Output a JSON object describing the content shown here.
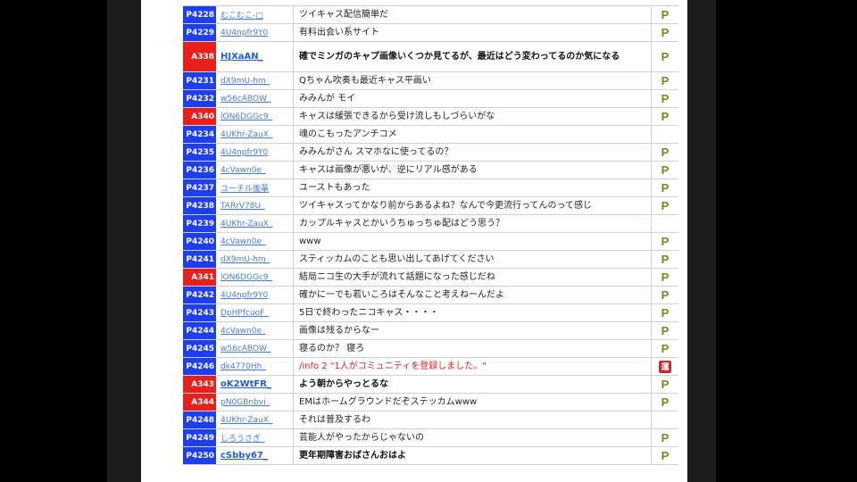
{
  "comments": [
    {
      "no": "P4228",
      "color": "blue",
      "user": "むこむこ-□",
      "user_bold": false,
      "text": "ツイキャス配信簡単だ",
      "text_style": "normal",
      "flag": "P"
    },
    {
      "no": "P4229",
      "color": "blue",
      "user": "4U4npfr9Y0",
      "user_bold": false,
      "text": "有料出会い系サイト",
      "text_style": "normal",
      "flag": "P"
    },
    {
      "no": "A338",
      "color": "red",
      "user": "HJXaAN_",
      "user_bold": true,
      "text": "確でミンガのキャプ画像いくつか見てるが、最近はどう変わってるのか気になる",
      "text_style": "bold",
      "flag": "P",
      "tall": true
    },
    {
      "no": "P4231",
      "color": "blue",
      "user": "dX9mU-hm_",
      "user_bold": false,
      "text": "Qちゃん吹奏も最近キャス平画い",
      "text_style": "normal",
      "flag": "P"
    },
    {
      "no": "P4232",
      "color": "blue",
      "user": "w56cABOW_",
      "user_bold": false,
      "text": "みみんが モイ",
      "text_style": "normal",
      "flag": "P"
    },
    {
      "no": "A340",
      "color": "red",
      "user": "lON6DGGc9_",
      "user_bold": false,
      "text": "キャスは緩張できるから受け流しもしづらいがな",
      "text_style": "normal",
      "flag": "P"
    },
    {
      "no": "P4234",
      "color": "blue",
      "user": "4UKhr-ZauX_",
      "user_bold": false,
      "text": "魂のこもったアンチコメ",
      "text_style": "normal",
      "flag": ""
    },
    {
      "no": "P4235",
      "color": "blue",
      "user": "4U4npfr9Y0",
      "user_bold": false,
      "text": "みみんがさん スマホなに使ってるの？",
      "text_style": "normal",
      "flag": "P"
    },
    {
      "no": "P4236",
      "color": "blue",
      "user": "4cVawn0e_",
      "user_bold": false,
      "text": "キャスは画像が悪いが、逆にリアル感がある",
      "text_style": "normal",
      "flag": "P"
    },
    {
      "no": "P4237",
      "color": "blue",
      "user": "ユーチル後輩",
      "user_bold": false,
      "text": "ユーストもあった",
      "text_style": "normal",
      "flag": "P"
    },
    {
      "no": "P4238",
      "color": "blue",
      "user": "TARrV78U_",
      "user_bold": false,
      "text": "ツイキャスってかなり前からあるよね？なんで今更流行ってんのって感じ",
      "text_style": "normal",
      "flag": "P"
    },
    {
      "no": "P4239",
      "color": "blue",
      "user": "4UKhr-ZauX_",
      "user_bold": false,
      "text": "カップルキャスとかいうちゅっちゅ配はどう思う？",
      "text_style": "normal",
      "flag": ""
    },
    {
      "no": "P4240",
      "color": "blue",
      "user": "4cVawn0e_",
      "user_bold": false,
      "text": "www",
      "text_style": "normal",
      "flag": "P"
    },
    {
      "no": "P4241",
      "color": "blue",
      "user": "dX9mU-hm_",
      "user_bold": false,
      "text": "スティッカムのことも思い出してあげてください",
      "text_style": "normal",
      "flag": "P"
    },
    {
      "no": "A341",
      "color": "red",
      "user": "lON6DGGc9_",
      "user_bold": false,
      "text": "結局ニコ生の大手が流れて話題になった感じだね",
      "text_style": "normal",
      "flag": "P"
    },
    {
      "no": "P4242",
      "color": "blue",
      "user": "4U4npfr9Y0",
      "user_bold": false,
      "text": "確かに一でも若いころはそんなこと考えねーんだよ",
      "text_style": "normal",
      "flag": "P"
    },
    {
      "no": "P4243",
      "color": "blue",
      "user": "DpHPfcuoF_",
      "user_bold": false,
      "text": "5日で終わったニコキャス・・・・",
      "text_style": "normal",
      "flag": "P"
    },
    {
      "no": "P4244",
      "color": "blue",
      "user": "4cVawn0e_",
      "user_bold": false,
      "text": "画像は残るからなー",
      "text_style": "normal",
      "flag": "P"
    },
    {
      "no": "P4245",
      "color": "blue",
      "user": "w56cABOW_",
      "user_bold": false,
      "text": "寝るのか？ 寝ろ",
      "text_style": "normal",
      "flag": "P"
    },
    {
      "no": "P4246",
      "color": "blue",
      "user": "dk4770Hh_",
      "user_bold": false,
      "text": "/info 2 \"1人がコミュニティを登録しました。\"",
      "text_style": "red",
      "flag": "X"
    },
    {
      "no": "A343",
      "color": "red",
      "user": "oK2WtFR_",
      "user_bold": true,
      "text": "よう朝からやっとるな",
      "text_style": "bold",
      "flag": "P"
    },
    {
      "no": "A344",
      "color": "red",
      "user": "pN0GBnbvi_",
      "user_bold": false,
      "text": "EMはホームグラウンドだぞステッカムwww",
      "text_style": "normal",
      "flag": "P"
    },
    {
      "no": "P4248",
      "color": "blue",
      "user": "4UKhr-ZauX_",
      "user_bold": false,
      "text": "それは普及するわ",
      "text_style": "normal",
      "flag": ""
    },
    {
      "no": "P4249",
      "color": "blue",
      "user": "しろうさぎ_",
      "user_bold": false,
      "text": "芸能人がやったからじゃないの",
      "text_style": "normal",
      "flag": "P"
    },
    {
      "no": "P4250",
      "color": "blue",
      "user": "cSbby67_",
      "user_bold": true,
      "text": "更年期障害おばさんおはよ",
      "text_style": "bold",
      "flag": "P"
    }
  ],
  "icons": {
    "premium": "premium-p-icon",
    "system": "system-flag-icon"
  }
}
